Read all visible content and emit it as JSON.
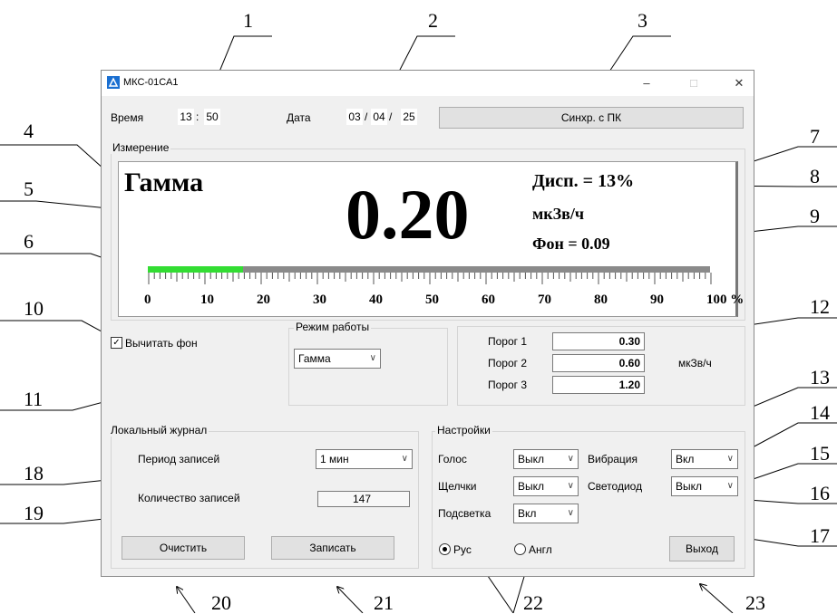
{
  "callouts": [
    "1",
    "2",
    "3",
    "4",
    "5",
    "6",
    "7",
    "8",
    "9",
    "10",
    "11",
    "12",
    "13",
    "14",
    "15",
    "16",
    "17",
    "18",
    "19",
    "20",
    "21",
    "22",
    "23"
  ],
  "window": {
    "title": "МКС-01СА1",
    "minimize": "–",
    "maximize": "□",
    "close": "✕"
  },
  "time": {
    "label": "Время",
    "hours": "13",
    "sep": ":",
    "minutes": "50"
  },
  "date": {
    "label": "Дата",
    "day": "03",
    "month": "04",
    "year": "25",
    "sep": "/"
  },
  "sync_button": "Синхр. с ПК",
  "measure": {
    "group_title": "Измерение",
    "mode_label": "Гамма",
    "value": "0.20",
    "disp": "Дисп. = 13%",
    "unit": "мкЗв/ч",
    "background": "Фон = 0.09",
    "progress_fraction": 0.17,
    "bar_fill_color": "#33dd33",
    "scale_labels": [
      "0",
      "10",
      "20",
      "30",
      "40",
      "50",
      "60",
      "70",
      "80",
      "90",
      "100 %"
    ]
  },
  "subtract_bg": {
    "label": "Вычитать фон",
    "checked": true,
    "check_mark": "✓"
  },
  "work_mode": {
    "title": "Режим работы",
    "value": "Гамма"
  },
  "thresholds": {
    "items": [
      {
        "label": "Порог 1",
        "value": "0.30"
      },
      {
        "label": "Порог 2",
        "value": "0.60"
      },
      {
        "label": "Порог 3",
        "value": "1.20"
      }
    ],
    "unit": "мкЗв/ч"
  },
  "journal": {
    "title": "Локальный журнал",
    "period_label": "Период записей",
    "period_value": "1 мин",
    "count_label": "Количество записей",
    "count_value": "147",
    "clear_button": "Очистить",
    "write_button": "Записать"
  },
  "settings": {
    "title": "Настройки",
    "voice_label": "Голос",
    "voice_value": "Выкл",
    "vibration_label": "Вибрация",
    "vibration_value": "Вкл",
    "clicks_label": "Щелчки",
    "clicks_value": "Выкл",
    "led_label": "Светодиод",
    "led_value": "Выкл",
    "backlight_label": "Подсветка",
    "backlight_value": "Вкл",
    "lang_ru": "Рус",
    "lang_en": "Англ",
    "lang_selected": "ru",
    "exit_button": "Выход"
  },
  "arrow_glyph": "∨"
}
